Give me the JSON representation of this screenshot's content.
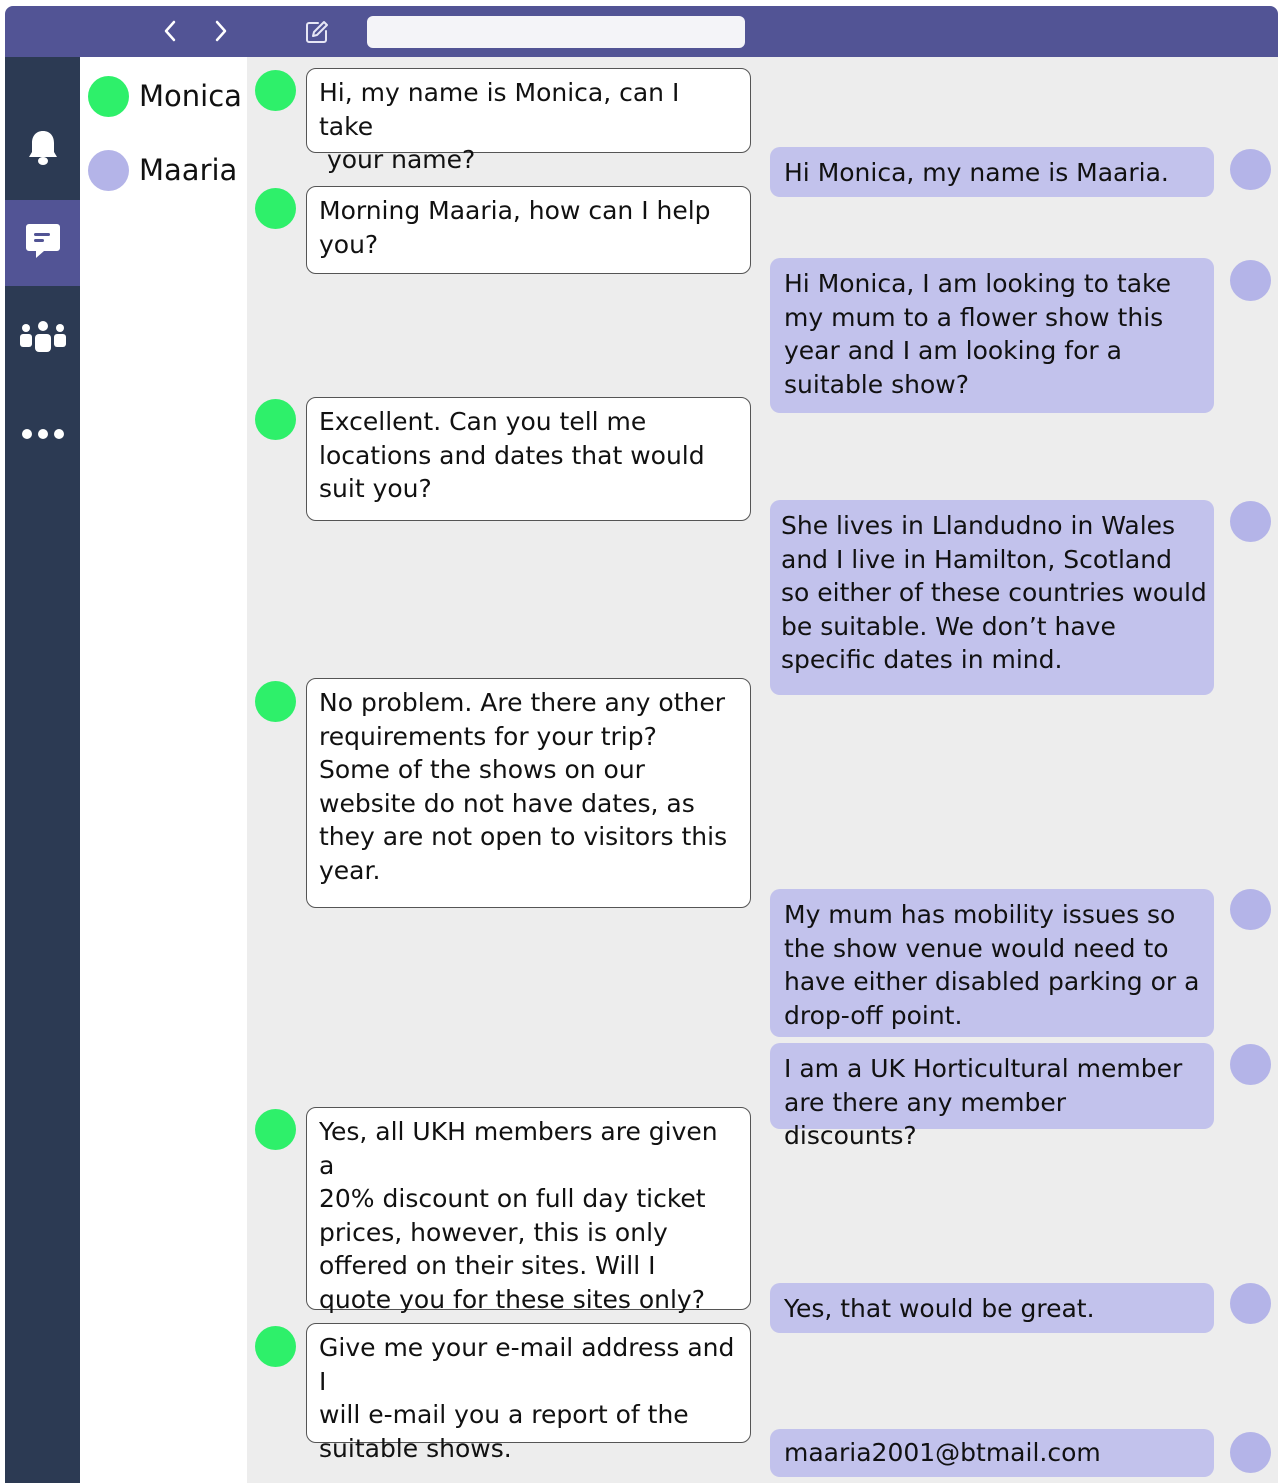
{
  "colors": {
    "header_bg": "#525495",
    "rail_bg": "#2c3a53",
    "rail_active": "#525495",
    "monica_avatar": "#2ef06a",
    "maaria_avatar": "#b4b4e8",
    "maaria_bubble": "#c2c2ec",
    "monica_bubble": "#ffffff",
    "chat_bg": "#ededed"
  },
  "header": {
    "back_icon": "chevron-left-icon",
    "forward_icon": "chevron-right-icon",
    "compose_icon": "compose-icon",
    "search_value": ""
  },
  "rail": {
    "items": [
      {
        "name": "notifications",
        "icon": "bell-icon"
      },
      {
        "name": "chat",
        "icon": "chat-icon",
        "active": true
      },
      {
        "name": "teams",
        "icon": "people-icon"
      },
      {
        "name": "more",
        "icon": "more-icon"
      }
    ]
  },
  "contacts": [
    {
      "name": "Monica",
      "color": "#2ef06a"
    },
    {
      "name": "Maaria",
      "color": "#b4b4e8"
    }
  ],
  "messages": [
    {
      "sender": "Monica",
      "text": "Hi, my name is Monica, can I take\n your name?"
    },
    {
      "sender": "Maaria",
      "text": "Hi Monica, my name is Maaria."
    },
    {
      "sender": "Monica",
      "text": "Morning Maaria, how can I help\nyou?"
    },
    {
      "sender": "Maaria",
      "text": "Hi Monica, I am looking to take\nmy mum to a flower show this\nyear and I am looking for a\nsuitable show?"
    },
    {
      "sender": "Monica",
      "text": "Excellent. Can you tell me\nlocations and dates that would\nsuit you?"
    },
    {
      "sender": "Maaria",
      "text": "She lives in Llandudno in Wales\nand I live in Hamilton, Scotland\nso either of these countries would\nbe suitable. We don’t have\nspecific dates in mind."
    },
    {
      "sender": "Monica",
      "text": "No problem. Are there any other\nrequirements for your trip?\nSome of the shows on our\nwebsite do not have dates, as\nthey are not open to visitors this\nyear."
    },
    {
      "sender": "Maaria",
      "text": "My mum has mobility issues so\nthe show venue would need to\nhave either disabled parking or a\ndrop-off point."
    },
    {
      "sender": "Maaria",
      "text": "I am a UK Horticultural member\nare there any member discounts?"
    },
    {
      "sender": "Monica",
      "text": "Yes, all UKH members are given a\n20% discount on full day ticket\nprices, however, this is only\noffered on their sites. Will I\nquote you for these sites only?"
    },
    {
      "sender": "Maaria",
      "text": "Yes, that would be great."
    },
    {
      "sender": "Monica",
      "text": "Give me your e-mail address and I\nwill e-mail you a report of the\nsuitable shows."
    },
    {
      "sender": "Maaria",
      "text": "maaria2001@btmail.com"
    }
  ]
}
